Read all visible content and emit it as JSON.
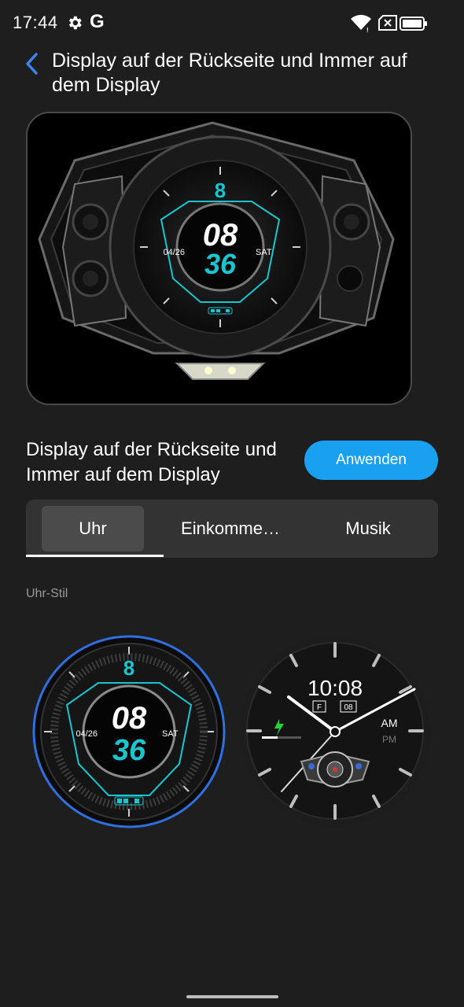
{
  "status_bar": {
    "time": "17:44",
    "google_letter": "G",
    "icons": [
      "gear-icon",
      "wifi-icon",
      "sim-off-icon",
      "battery-icon"
    ]
  },
  "header": {
    "title": "Display auf der Rückseite und Immer auf dem Display",
    "back_icon": "chevron-left-icon",
    "accent_color": "#3b82f6"
  },
  "preview": {
    "hour": "08",
    "minute": "36",
    "date": "04/26",
    "weekday": "SAT"
  },
  "apply": {
    "label": "Display auf der Rückseite und Immer auf dem Display",
    "button_label": "Anwenden",
    "button_color": "#1aa0f0"
  },
  "tabs": {
    "items": [
      {
        "label": "Uhr",
        "active": true
      },
      {
        "label": "Einkomme…",
        "active": false
      },
      {
        "label": "Musik",
        "active": false
      }
    ]
  },
  "section": {
    "label": "Uhr-Stil"
  },
  "watch_styles": [
    {
      "hour": "08",
      "minute": "36",
      "date": "04/26",
      "weekday": "SAT",
      "selected": true,
      "selection_color": "#2f6fe0"
    },
    {
      "time": "10:08",
      "day_letter": "F",
      "day_number": "08",
      "am": "AM",
      "pm": "PM",
      "selected": false
    }
  ]
}
